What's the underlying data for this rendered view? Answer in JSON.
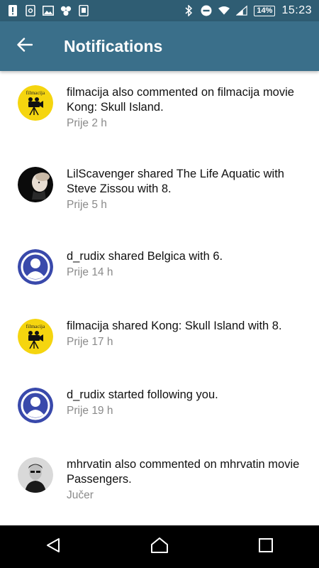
{
  "status_bar": {
    "battery": "14%",
    "time": "15:23"
  },
  "app_bar": {
    "title": "Notifications"
  },
  "notifications": [
    {
      "avatar": "filmacija-logo",
      "avatar_text": "filmacija",
      "message": "filmacija also commented on filmacija movie Kong: Skull Island.",
      "time": "Prije 2 h"
    },
    {
      "avatar": "user-photo",
      "message": "LilScavenger shared The Life Aquatic with Steve Zissou with 8.",
      "time": "Prije 5 h"
    },
    {
      "avatar": "default-user-icon",
      "message": "d_rudix shared Belgica with 6.",
      "time": "Prije 14 h"
    },
    {
      "avatar": "filmacija-logo",
      "avatar_text": "filmacija",
      "message": "filmacija shared Kong: Skull Island with 8.",
      "time": "Prije 17 h"
    },
    {
      "avatar": "default-user-icon",
      "message": "d_rudix started following you.",
      "time": "Prije 19 h"
    },
    {
      "avatar": "user-photo",
      "message": "mhrvatin also commented on mhrvatin movie Passengers.",
      "time": "Jučer"
    }
  ],
  "colors": {
    "status_bar": "#2f5d73",
    "app_bar": "#3a6f8a",
    "filmacija_yellow": "#f5d50f",
    "default_avatar_blue": "#3949ab",
    "nav_bar": "#000000"
  }
}
